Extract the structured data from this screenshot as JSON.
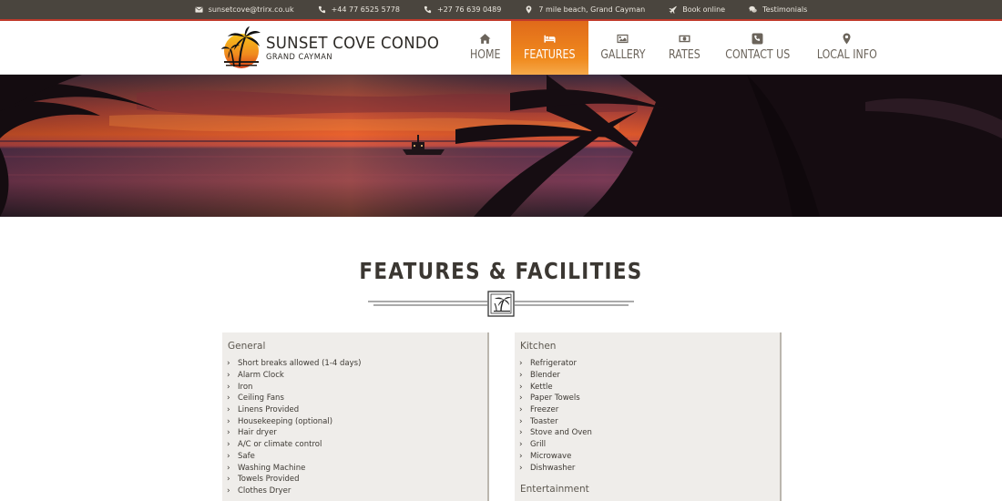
{
  "topbar": {
    "items": [
      {
        "icon": "envelope-icon",
        "label": "sunsetcove@trirx.co.uk"
      },
      {
        "icon": "phone-icon",
        "label": "+44 77 6525 5778"
      },
      {
        "icon": "phone-icon",
        "label": "+27 76 639 0489"
      },
      {
        "icon": "map-marker-icon",
        "label": "7 mile beach, Grand Cayman"
      },
      {
        "icon": "plane-icon",
        "label": "Book online"
      },
      {
        "icon": "comments-icon",
        "label": "Testimonials"
      }
    ]
  },
  "logo": {
    "title": "SUNSET COVE CONDO",
    "subtitle": "GRAND CAYMAN"
  },
  "nav": {
    "items": [
      {
        "icon": "home-icon",
        "label": "HOME",
        "active": false
      },
      {
        "icon": "bed-icon",
        "label": "FEATURES",
        "active": true
      },
      {
        "icon": "image-icon",
        "label": "GALLERY",
        "active": false
      },
      {
        "icon": "money-icon",
        "label": "RATES",
        "active": false
      },
      {
        "icon": "phone-square-icon",
        "label": "CONTACT US",
        "active": false
      },
      {
        "icon": "map-marker-icon",
        "label": "LOCAL INFO",
        "active": false
      }
    ]
  },
  "page": {
    "heading": "FEATURES & FACILITIES"
  },
  "panels": {
    "general": {
      "title": "General",
      "items": [
        "Short breaks allowed (1-4 days)",
        "Alarm Clock",
        "Iron",
        "Ceiling Fans",
        "Linens Provided",
        "Housekeeping (optional)",
        "Hair dryer",
        "A/C or climate control",
        "Safe",
        "Washing Machine",
        "Towels Provided",
        "Clothes Dryer"
      ]
    },
    "kitchen": {
      "title": "Kitchen",
      "items": [
        "Refrigerator",
        "Blender",
        "Kettle",
        "Paper Towels",
        "Freezer",
        "Toaster",
        "Stove and Oven",
        "Grill",
        "Microwave",
        "Dishwasher"
      ],
      "next_section": "Entertainment"
    }
  },
  "colors": {
    "topbar": "#4a453e",
    "accent_red": "#c0392b",
    "active_nav": "#f08a1e",
    "panel_bg": "#efedea"
  }
}
